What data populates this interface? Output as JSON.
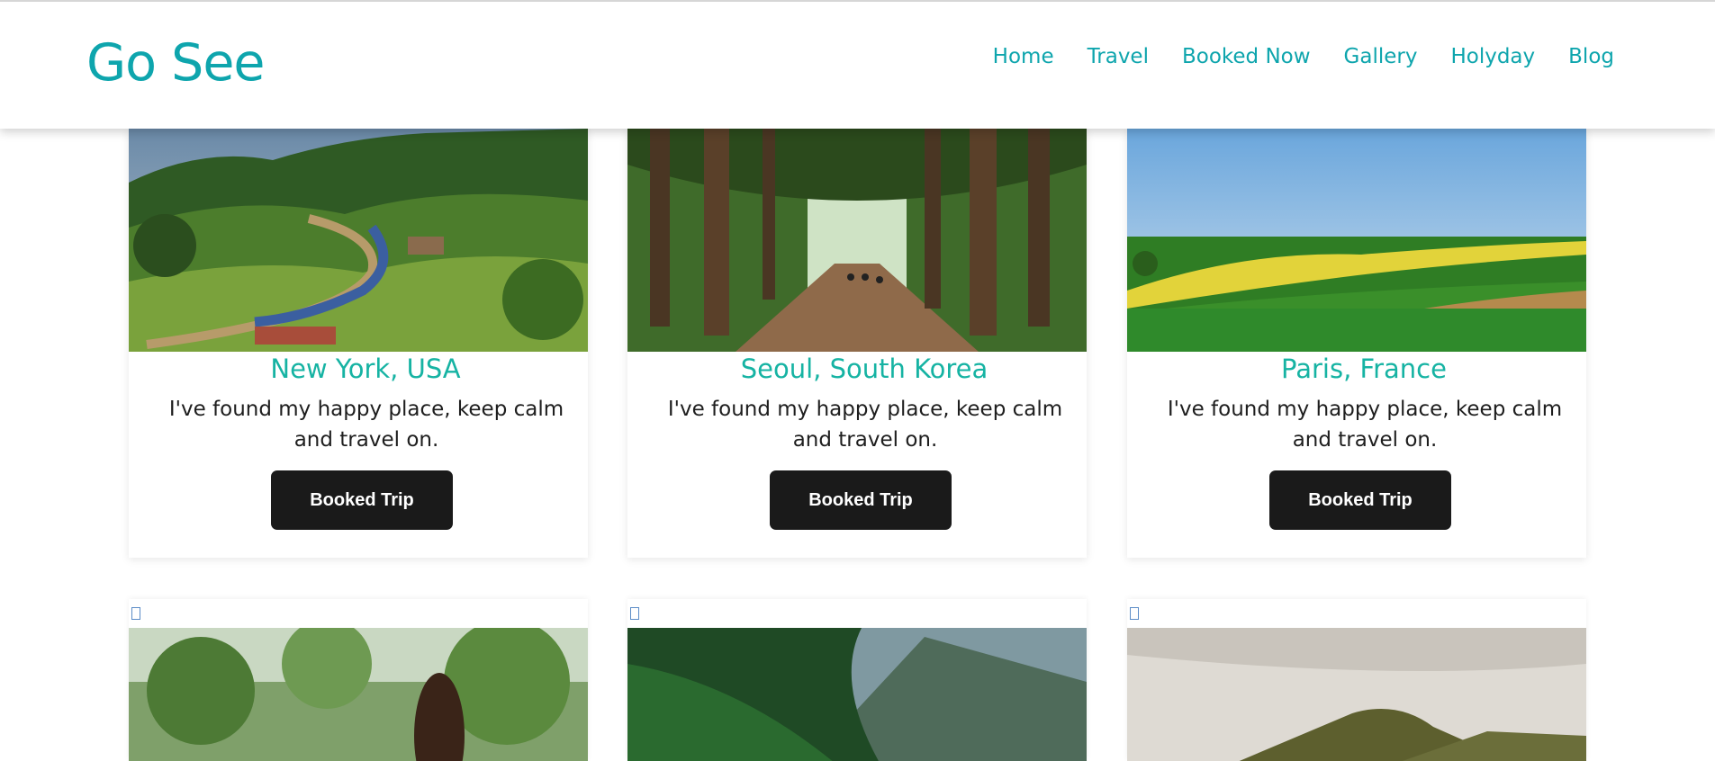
{
  "brand": {
    "name": "Go See"
  },
  "nav": {
    "items": [
      {
        "label": "Home"
      },
      {
        "label": "Travel"
      },
      {
        "label": "Booked Now"
      },
      {
        "label": "Gallery"
      },
      {
        "label": "Holyday"
      },
      {
        "label": "Blog"
      }
    ]
  },
  "cards": [
    {
      "title": "New York, USA",
      "text": "I've found my happy place, keep calm and travel on.",
      "button": "Booked Trip",
      "image": "train-through-hills"
    },
    {
      "title": "Seoul, South Korea",
      "text": "I've found my happy place, keep calm and travel on.",
      "button": "Booked Trip",
      "image": "tree-lined-road-cyclists"
    },
    {
      "title": "Paris, France",
      "text": "I've found my happy place, keep calm and travel on.",
      "button": "Booked Trip",
      "image": "green-and-yellow-fields"
    }
  ],
  "row2": [
    {
      "image": "woman-in-forest"
    },
    {
      "image": "forested-mountain"
    },
    {
      "image": "grassy-peak-cloudy-sky"
    }
  ],
  "colors": {
    "accent": "#0ea5ad",
    "title": "#16b3a3",
    "button": "#1a1a1a"
  }
}
